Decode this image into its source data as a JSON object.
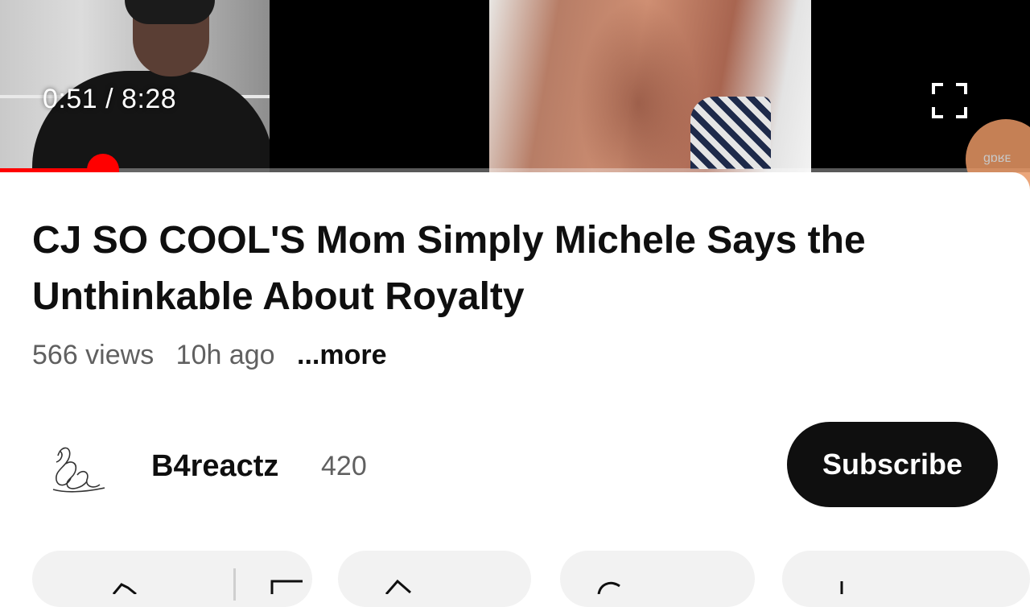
{
  "player": {
    "current_time": "0:51",
    "separator": "/",
    "duration": "8:28",
    "progress_fraction": 0.1,
    "ghost_label": "ɡɒʁᴇ"
  },
  "video": {
    "title": "CJ SO COOL'S Mom Simply Michele Says the Unthinkable About Royalty",
    "views": "566 views",
    "age": "10h ago",
    "more_label": "...more"
  },
  "channel": {
    "name": "B4reactz",
    "subscriber_count": "420",
    "subscribe_label": "Subscribe",
    "avatar_icon": "signature-logo-icon"
  },
  "action_chips": [
    {
      "icon": "like-dislike-icon"
    },
    {
      "icon": "share-icon"
    },
    {
      "icon": "remix-icon"
    },
    {
      "icon": "download-icon"
    }
  ],
  "colors": {
    "progress": "#ff0000",
    "subscribe_bg": "#0f0f0f",
    "chip_bg": "#f2f2f2"
  }
}
